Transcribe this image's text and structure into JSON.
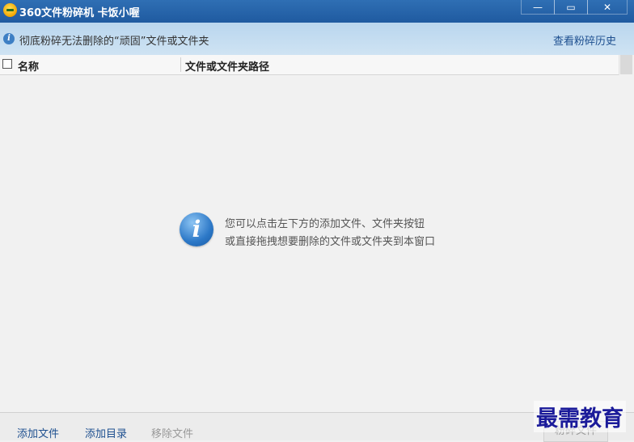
{
  "window": {
    "title": "360文件粉碎机  卡饭小喔",
    "controls": [
      "—",
      "▭",
      "✕"
    ]
  },
  "infobar": {
    "text": "彻底粉碎无法删除的“顽固”文件或文件夹",
    "history_link": "查看粉碎历史"
  },
  "table": {
    "columns": [
      "名称",
      "文件或文件夹路径"
    ]
  },
  "empty_state": {
    "icon_glyph": "i",
    "line1": "您可以点击左下方的添加文件、文件夹按钮",
    "line2": "或直接拖拽想要删除的文件或文件夹到本窗口"
  },
  "bottom": {
    "add_file": "添加文件",
    "add_dir": "添加目录",
    "remove_file": "移除文件",
    "shred_file": "粉碎文件"
  },
  "watermark": "最需教育",
  "colors": {
    "titlebar": "#1f5aa0",
    "link": "#1d4f8f"
  }
}
